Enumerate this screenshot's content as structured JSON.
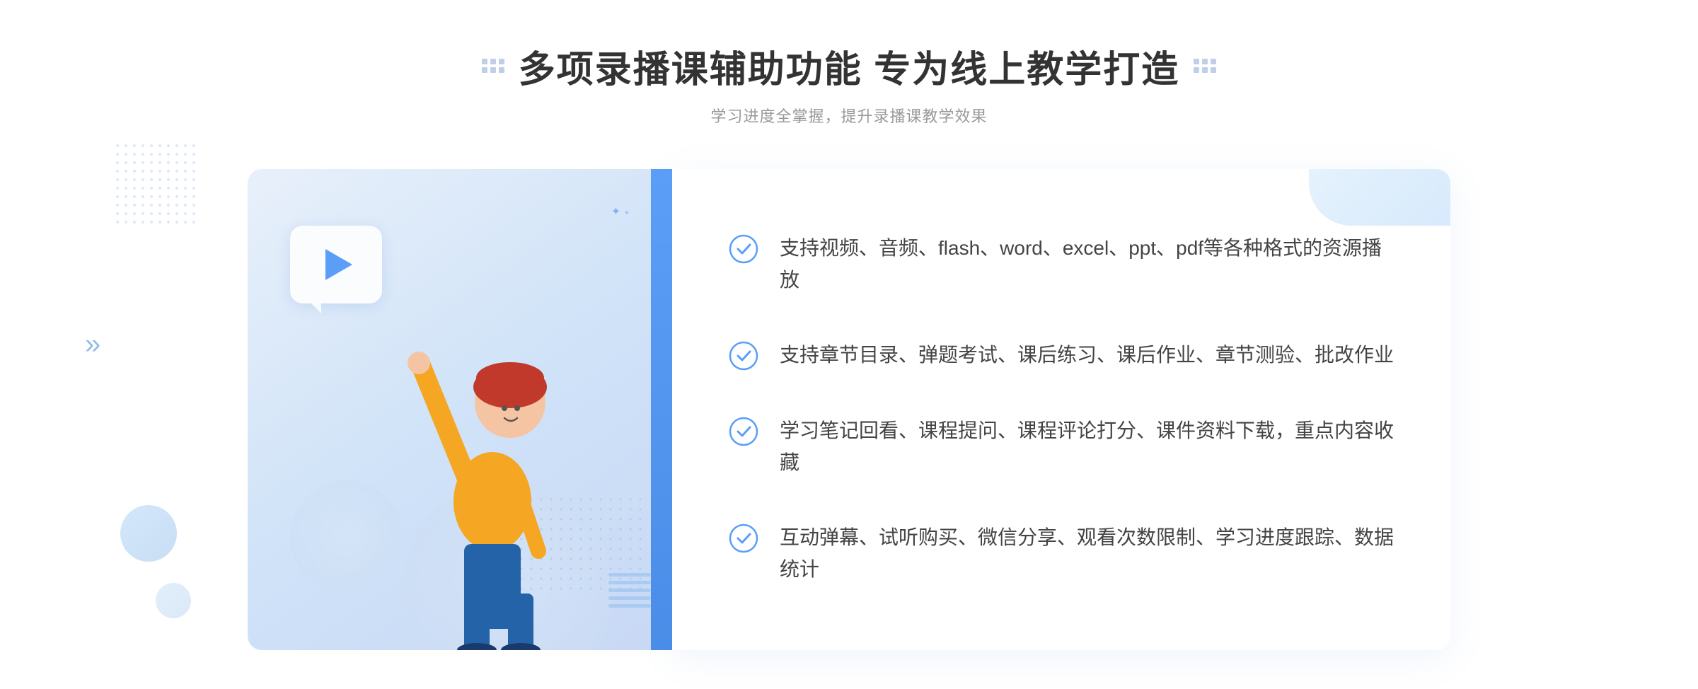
{
  "header": {
    "title": "多项录播课辅助功能 专为线上教学打造",
    "subtitle": "学习进度全掌握，提升录播课教学效果"
  },
  "features": [
    {
      "id": 1,
      "text": "支持视频、音频、flash、word、excel、ppt、pdf等各种格式的资源播放"
    },
    {
      "id": 2,
      "text": "支持章节目录、弹题考试、课后练习、课后作业、章节测验、批改作业"
    },
    {
      "id": 3,
      "text": "学习笔记回看、课程提问、课程评论打分、课件资料下载，重点内容收藏"
    },
    {
      "id": 4,
      "text": "互动弹幕、试听购买、微信分享、观看次数限制、学习进度跟踪、数据统计"
    }
  ],
  "colors": {
    "accent_blue": "#4a8de8",
    "light_blue": "#5b9ef7",
    "text_dark": "#333333",
    "text_medium": "#444444",
    "text_light": "#999999",
    "check_blue": "#5b9ef7"
  }
}
